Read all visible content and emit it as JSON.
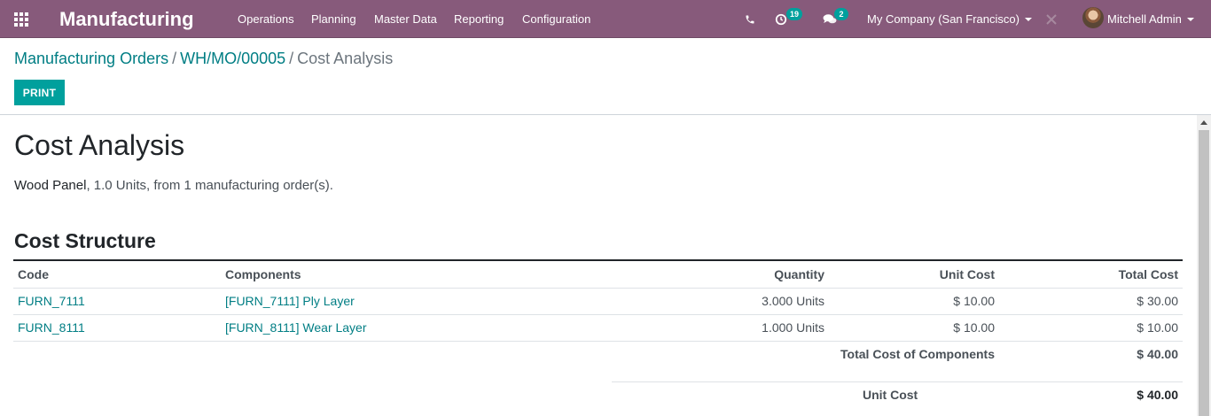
{
  "navbar": {
    "app_icon": "apps-grid-icon",
    "brand": "Manufacturing",
    "menu": [
      "Operations",
      "Planning",
      "Master Data",
      "Reporting",
      "Configuration"
    ],
    "phone_icon": "phone-icon",
    "activity_icon": "activity-clock-icon",
    "activity_count": "19",
    "chat_icon": "chat-bubbles-icon",
    "message_count": "2",
    "company": "My Company (San Francisco)",
    "close_icon": "close-x-icon",
    "user": "Mitchell Admin"
  },
  "breadcrumb": {
    "items": [
      "Manufacturing Orders",
      "WH/MO/00005"
    ],
    "separator": "/",
    "current": "Cost Analysis"
  },
  "buttons": {
    "print": "PRINT"
  },
  "report": {
    "title": "Cost Analysis",
    "product": "Wood Panel",
    "summary_rest": ", 1.0 Units, from 1 manufacturing order(s).",
    "section_title": "Cost Structure",
    "columns": [
      "Code",
      "Components",
      "Quantity",
      "Unit Cost",
      "Total Cost"
    ],
    "rows": [
      {
        "code": "FURN_7111",
        "component": "[FURN_7111] Ply Layer",
        "quantity": "3.000 Units",
        "unit_cost": "$ 10.00",
        "total_cost": "$ 30.00"
      },
      {
        "code": "FURN_8111",
        "component": "[FURN_8111] Wear Layer",
        "quantity": "1.000 Units",
        "unit_cost": "$ 10.00",
        "total_cost": "$ 10.00"
      }
    ],
    "total_components_label": "Total Cost of Components",
    "total_components_value": "$ 40.00",
    "unit_cost_label": "Unit Cost",
    "unit_cost_value": "$ 40.00"
  },
  "colors": {
    "navbar": "#875a7b",
    "primary": "#00a09d",
    "link": "#017e84"
  }
}
